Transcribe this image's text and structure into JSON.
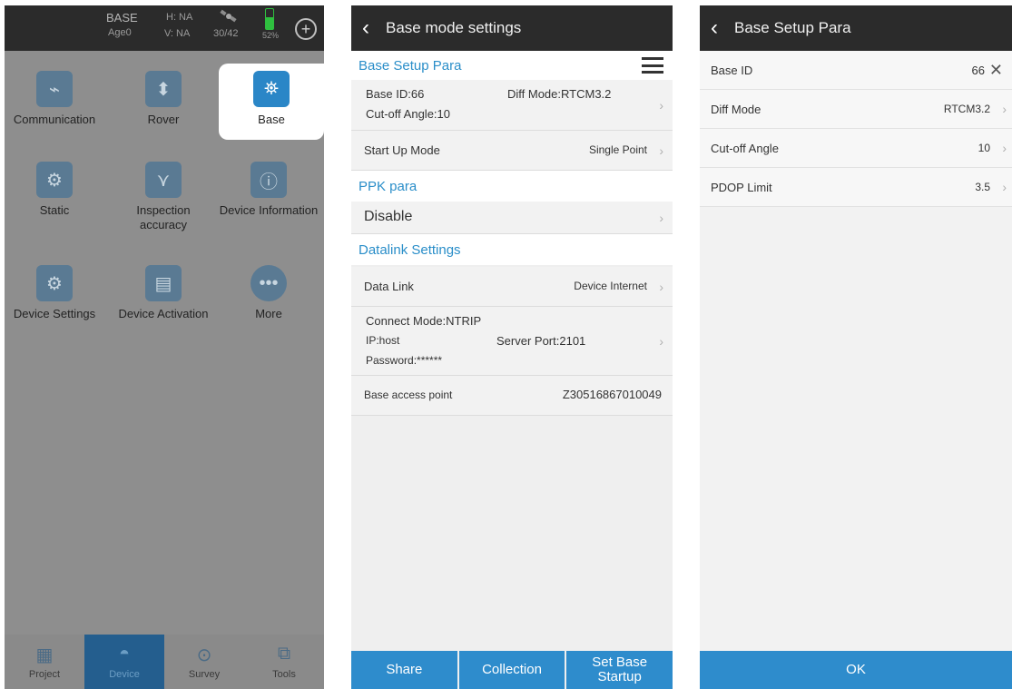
{
  "screen1": {
    "status": {
      "mode": "BASE",
      "age": "Age0",
      "h": "H: NA",
      "v": "V: NA",
      "satellites": "30/42",
      "battery": "52%",
      "plus_icon": "plus-circle-icon"
    },
    "tiles": [
      {
        "label": "Communication",
        "icon": "communication-icon"
      },
      {
        "label": "Rover",
        "icon": "rover-icon"
      },
      {
        "label": "Base",
        "icon": "base-icon",
        "active": true
      },
      {
        "label": "Static",
        "icon": "static-icon"
      },
      {
        "label": "Inspection accuracy",
        "icon": "inspection-icon"
      },
      {
        "label": "Device Information",
        "icon": "info-icon"
      },
      {
        "label": "Device Settings",
        "icon": "device-settings-icon"
      },
      {
        "label": "Device Activation",
        "icon": "activation-icon"
      },
      {
        "label": "More",
        "icon": "more-icon"
      }
    ],
    "tabs": [
      {
        "label": "Project",
        "icon": "project-icon"
      },
      {
        "label": "Device",
        "icon": "device-icon",
        "selected": true
      },
      {
        "label": "Survey",
        "icon": "survey-icon"
      },
      {
        "label": "Tools",
        "icon": "tools-icon"
      }
    ]
  },
  "screen2": {
    "title": "Base mode settings",
    "base_setup_title": "Base Setup Para",
    "base_id": "Base ID:66",
    "diff_mode": "Diff Mode:RTCM3.2",
    "cutoff": "Cut-off Angle:10",
    "startup_label": "Start Up Mode",
    "startup_value": "Single Point",
    "ppk_title": "PPK para",
    "ppk_value": "Disable",
    "datalink_title": "Datalink Settings",
    "datalink_label": "Data Link",
    "datalink_value": "Device Internet",
    "connect_mode": "Connect Mode:NTRIP",
    "ip": "IP:host",
    "server_port": "Server Port:2101",
    "password": "Password:******",
    "access_label": "Base access point",
    "access_value": "Z30516867010049",
    "buttons": {
      "share": "Share",
      "collection": "Collection",
      "startup_line1": "Set Base",
      "startup_line2": "Startup"
    }
  },
  "screen3": {
    "title": "Base Setup Para",
    "rows": [
      {
        "label": "Base ID",
        "value": "66"
      },
      {
        "label": "Diff Mode",
        "value": "RTCM3.2"
      },
      {
        "label": "Cut-off Angle",
        "value": "10"
      },
      {
        "label": "PDOP Limit",
        "value": "3.5"
      }
    ],
    "ok": "OK"
  },
  "colors": {
    "accent": "#2e8ccc",
    "header": "#2b2b2b",
    "section_title": "#2a8ec9"
  }
}
